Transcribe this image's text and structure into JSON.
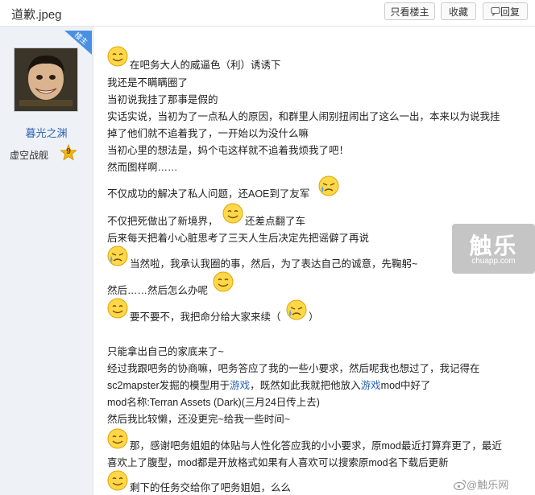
{
  "header": {
    "title": "道歉.jpeg",
    "buttons": {
      "only_op": "只看楼主",
      "favorite": "收藏",
      "reply": "回复"
    }
  },
  "author": {
    "badge": "楼主",
    "name": "暮光之渊",
    "level_title": "虚空战舰",
    "level": "9"
  },
  "post": {
    "l1": "在吧务大人的威逼色（利）诱诱下",
    "l2": "我还是不瞒瞒圈了",
    "l3": "当初说我挂了那事是假的",
    "l4": "实话实说，当初为了一点私人的原因，和群里人闹别扭闹出了这么一出，本来以为说我挂",
    "l5": "掉了他们就不追着我了，一开始以为没什么嘛",
    "l6": "当初心里的想法是，妈个屯这样就不追着我烦我了吧！",
    "l7": "然而图样啊……",
    "l8": "不仅成功的解决了私人问题，还AOE到了友军",
    "l9a": "不仅把死做出了新境界，",
    "l9b": "还差点翻了车",
    "l10": "后来每天把着小心脏思考了三天人生后决定先把谣僻了再说",
    "l11": "当然啦，我承认我圈的事，然后，为了表达自己的诚意，先鞠躬~",
    "l12": "然后……然后怎么办呢",
    "l13a": "要不要不，我把命分给大家来续（",
    "l13b": "）",
    "l14": "只能拿出自己的家底来了~",
    "l15": "经过我跟吧务的协商嘛，吧务答应了我的一些小要求，然后呢我也想过了，我记得在",
    "l16a": "sc2mapster发掘的模型用于",
    "l16link1": "游戏",
    "l16b": "，既然如此我就把他放入",
    "l16link2": "游戏",
    "l16c": "mod中好了",
    "l17": "mod名称:Terran Assets (Dark)(三月24日传上去)",
    "l18": "然后我比较懒，还没更完~给我一些时间~",
    "l19": "那，感谢吧务姐姐的体贴与人性化答应我的小小要求，原mod最近打算弃更了，最近",
    "l20": "喜欢上了腹型，mod都是开放格式如果有人喜欢可以搜索原mod名下载后更新",
    "l21": "剩下的任务交给你了吧务姐姐，么么"
  },
  "watermark": {
    "logo_text": "触乐",
    "site": "chuapp.com",
    "bottom": "@触乐网"
  },
  "colors": {
    "link": "#2d64b3",
    "sidebar_bg": "#eef1f6",
    "badge": "#4a90e2"
  },
  "icons": [
    "smile-emoji-icon",
    "crying-emoji-icon",
    "weibo-icon",
    "star-level-icon"
  ]
}
